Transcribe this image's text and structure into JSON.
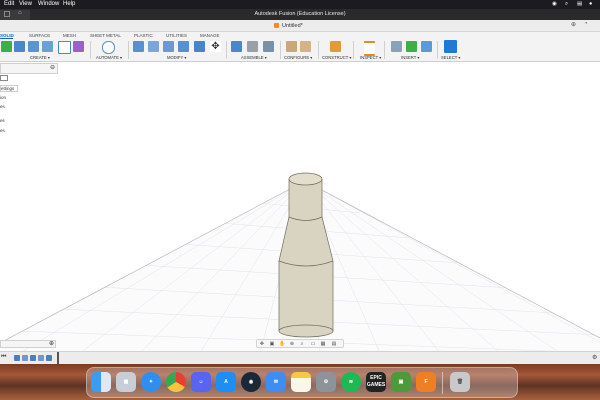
{
  "menubar": {
    "items": [
      "Edit",
      "View",
      "Window",
      "Help"
    ],
    "time": "",
    "icons": [
      "wifi-icon",
      "search-icon",
      "control-center-icon",
      "siri-icon"
    ]
  },
  "window": {
    "title": "Autodesk Fusion (Education License)"
  },
  "document": {
    "tab_label": "Untitled*"
  },
  "ribbon": {
    "tabs": [
      "SOLID",
      "SURFACE",
      "MESH",
      "SHEET METAL",
      "PLASTIC",
      "UTILITIES",
      "MANAGE"
    ],
    "active_tab": "SOLID",
    "groups": [
      "CREATE ▾",
      "AUTOMATE ▾",
      "MODIFY ▾",
      "ASSEMBLE ▾",
      "CONFIGURE ▾",
      "CONSTRUCT ▾",
      "INSPECT ▾",
      "INSERT ▾",
      "SELECT ▾"
    ]
  },
  "browser": {
    "rows": [
      "ettings",
      "ion",
      "es",
      "es",
      "es"
    ]
  },
  "dock": {
    "apps": [
      "Finder",
      "Launchpad",
      "Safari",
      "Chrome",
      "Discord",
      "App Store",
      "Steam",
      "Mail",
      "Notes",
      "System Settings",
      "Spotify",
      "Epic Games",
      "Minecraft",
      "Fusion",
      "Trash"
    ],
    "epic_label": "EPIC GAMES"
  },
  "colors": {
    "accent": "#0a64c8",
    "model_fill": "#d9d4c2",
    "model_stroke": "#6f6b5e",
    "grid": "#d7dbe2"
  }
}
